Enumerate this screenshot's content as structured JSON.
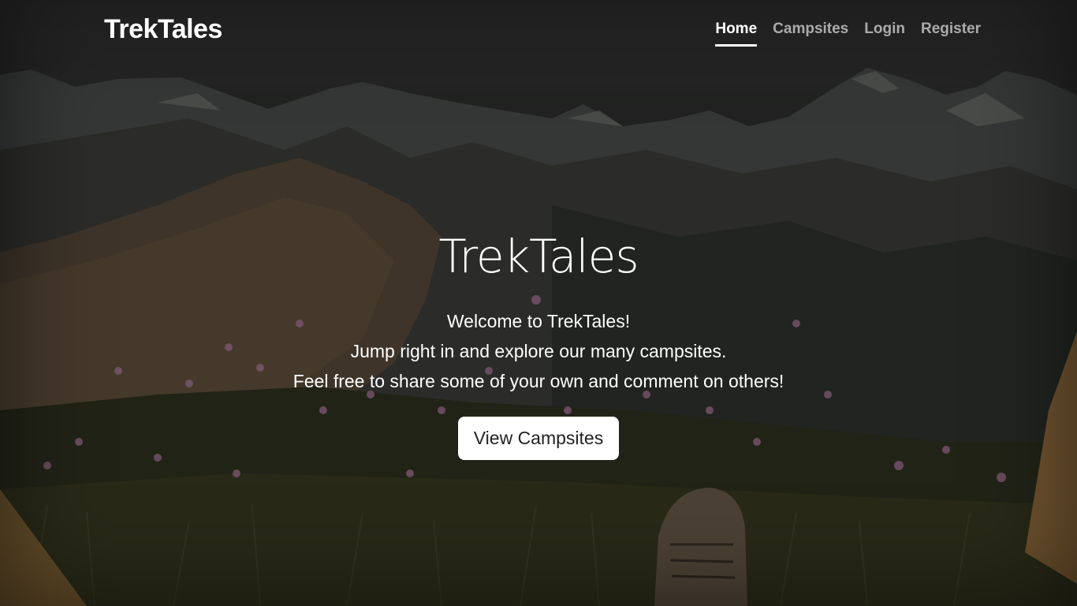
{
  "header": {
    "brand": "TrekTales",
    "nav": [
      {
        "label": "Home",
        "active": true
      },
      {
        "label": "Campsites",
        "active": false
      },
      {
        "label": "Login",
        "active": false
      },
      {
        "label": "Register",
        "active": false
      }
    ]
  },
  "hero": {
    "title": "TrekTales",
    "lines": [
      "Welcome to TrekTales!",
      "Jump right in and explore our many campsites.",
      "Feel free to share some of your own and comment on others!"
    ],
    "cta_label": "View Campsites"
  },
  "colors": {
    "text": "#ffffff",
    "nav_inactive": "rgba(255,255,255,0.62)",
    "button_bg": "#ffffff",
    "button_text": "#222222"
  }
}
